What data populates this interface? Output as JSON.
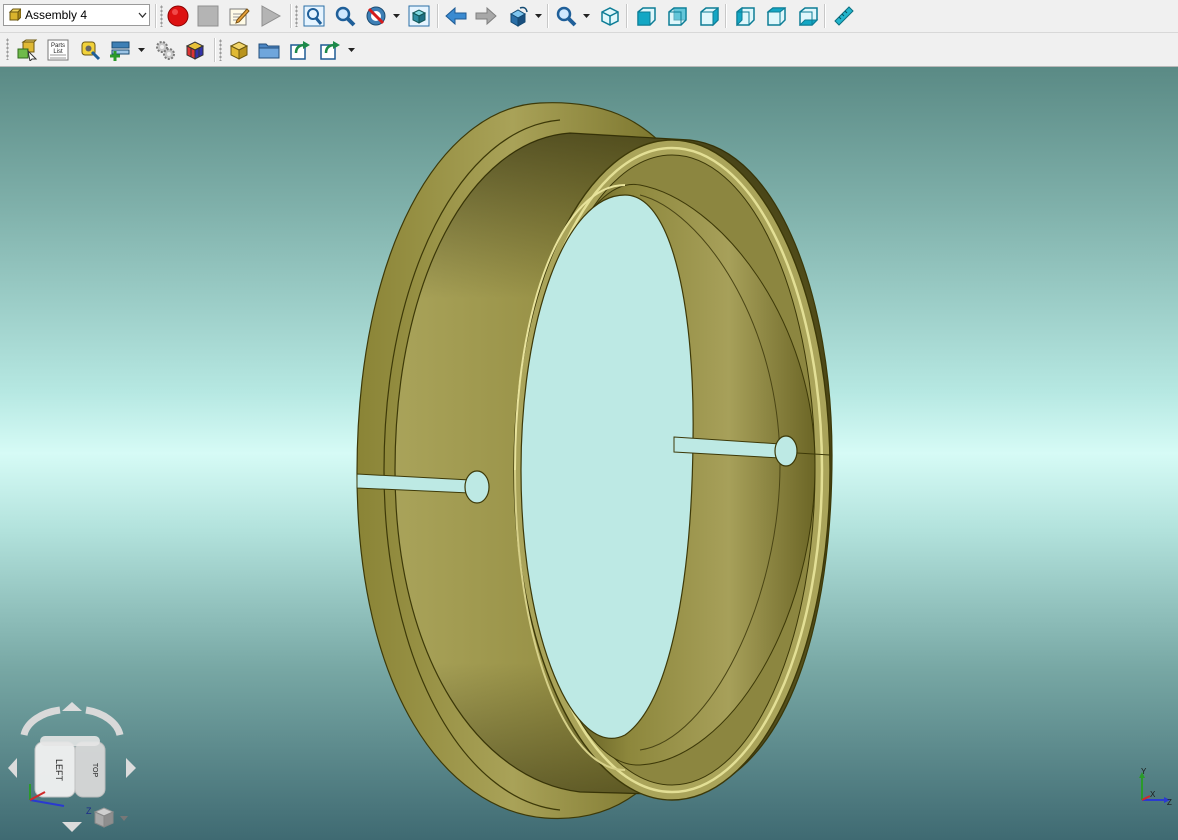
{
  "window": {
    "assembly_selector": {
      "value": "Assembly 4",
      "icon": "assembly-icon"
    }
  },
  "toolbar_top": {
    "buttons": [
      "record-macro",
      "stop-macro",
      "edit-macro",
      "play-macro",
      "zoom-fit",
      "zoom-window",
      "render-mode",
      "shaded-view",
      "previous-view",
      "next-view",
      "view-orientation",
      "zoom",
      "iso-view",
      "front-view",
      "back-view",
      "right-view",
      "left-view",
      "top-view",
      "bottom-view",
      "measure"
    ]
  },
  "toolbar_second": {
    "parts_list_label": "Parts\nList",
    "buttons": [
      "component-select",
      "parts-list",
      "measure-distance",
      "insert-component",
      "settings",
      "cube-pattern",
      "open-part",
      "open-folder",
      "export",
      "export-options"
    ]
  },
  "view_cube": {
    "face_front": "LEFT",
    "face_side": "TOP",
    "axis_z": "Z"
  },
  "triad": {
    "y": "Y",
    "x": "X",
    "z": "Z"
  },
  "colors": {
    "model": "#a7a056",
    "model_dark": "#4f4a18",
    "bg_top": "#5a8a85",
    "bg_mid": "#d6fbf6",
    "bg_bottom": "#3f6a72",
    "record": "#dd1111"
  }
}
